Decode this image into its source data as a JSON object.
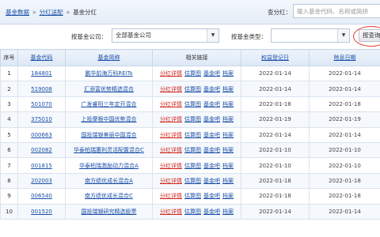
{
  "breadcrumb": {
    "home": "基金数据",
    "section": "分红送配",
    "current": "基金分红",
    "separator": "»"
  },
  "search": {
    "label": "查分红：",
    "placeholder": "输入基金代码、名称或简拼"
  },
  "filters": {
    "company_label": "按基金公司：",
    "company_value": "全部基金公司",
    "type_label": "按基金类型：",
    "type_value": "",
    "query_button": "按查询"
  },
  "table": {
    "headers": [
      "序号",
      "基金代码",
      "基金简称",
      "相关链接",
      "权益登记日",
      "除息日期"
    ],
    "link_labels": {
      "dividend": "分红详情",
      "guba": "估算图",
      "ba": "基金吧",
      "archive": "档案"
    },
    "rows": [
      {
        "seq": "1",
        "code": "184801",
        "name": "鹏华前海万科REITs",
        "reg_date": "2022-01-14",
        "ex_date": "2022-01-14"
      },
      {
        "seq": "2",
        "code": "519008",
        "name": "汇添富优势精选混合",
        "reg_date": "2022-01-14",
        "ex_date": "2022-01-14"
      },
      {
        "seq": "3",
        "code": "501070",
        "name": "广发睿阳三年定开混合",
        "reg_date": "2022-01-18",
        "ex_date": "2022-01-18"
      },
      {
        "seq": "4",
        "code": "375010",
        "name": "上投摩根中国优势混合",
        "reg_date": "2022-01-19",
        "ex_date": "2022-01-19"
      },
      {
        "seq": "5",
        "code": "000663",
        "name": "国投瑞银美丽中国混合",
        "reg_date": "2022-01-14",
        "ex_date": "2022-01-14"
      },
      {
        "seq": "6",
        "code": "002082",
        "name": "华泰柏瑞惠利灵活配置混合C",
        "reg_date": "2022-01-10",
        "ex_date": "2022-01-10"
      },
      {
        "seq": "7",
        "code": "001815",
        "name": "华泰柏瑞激励动力混合A",
        "reg_date": "2022-01-10",
        "ex_date": "2022-01-10"
      },
      {
        "seq": "8",
        "code": "202003",
        "name": "南方绩优成长混合A",
        "reg_date": "2022-01-18",
        "ex_date": "2022-01-18"
      },
      {
        "seq": "9",
        "code": "006540",
        "name": "南方绩优成长混合C",
        "reg_date": "2022-01-18",
        "ex_date": "2022-01-18"
      },
      {
        "seq": "10",
        "code": "001520",
        "name": "国投瑞银研究精选股票",
        "reg_date": "2022-01-14",
        "ex_date": "2022-01-14"
      }
    ]
  },
  "colors": {
    "link": "#1a4fa8",
    "red_link": "#d0261c",
    "annotation": "#e23a2f"
  },
  "icons": {
    "dropdown": "chevron-down-icon"
  }
}
